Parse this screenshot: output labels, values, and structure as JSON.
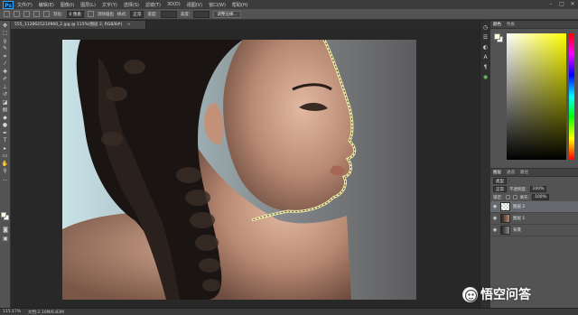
{
  "app": {
    "logo_text": "Ps",
    "menu": [
      "文件(F)",
      "编辑(E)",
      "图像(I)",
      "图层(L)",
      "文字(Y)",
      "选择(S)",
      "滤镜(T)",
      "3D(D)",
      "视图(V)",
      "窗口(W)",
      "帮助(H)"
    ],
    "window_buttons": [
      "–",
      "□",
      "✕"
    ]
  },
  "options": {
    "feather_label": "羽化:",
    "feather_value": "0 像素",
    "antialias_label": "消除锯齿",
    "style_label": "样式:",
    "style_value": "正常",
    "width_label": "宽度:",
    "height_label": "高度:",
    "refine_edge_button": "调整边缘..."
  },
  "document": {
    "tab_title": "555_1128625210960_2.jpg @ 115%(图层 2, RGB/8#)",
    "tab_close": "×"
  },
  "status": {
    "zoom": "115.17%",
    "doc_info": "文档:2.10M/6.83M"
  },
  "right_panel": {
    "color_tabs": [
      "颜色",
      "色板"
    ],
    "layers_tabs": [
      "图层",
      "通道",
      "路径"
    ],
    "kind_label": "类型",
    "blend_mode": "正常",
    "opacity_label": "不透明度:",
    "opacity_value": "100%",
    "lock_label": "锁定:",
    "fill_label": "填充:",
    "fill_value": "100%",
    "layers": [
      {
        "name": "图层 2",
        "selected": true
      },
      {
        "name": "图层 1",
        "selected": false
      },
      {
        "name": "背景",
        "selected": false
      }
    ]
  },
  "watermark": {
    "text": "悟空问答"
  },
  "colors": {
    "foreground": "#fffde0",
    "selection": "#f5f0a8",
    "accent_blue": "#30a8ff"
  }
}
